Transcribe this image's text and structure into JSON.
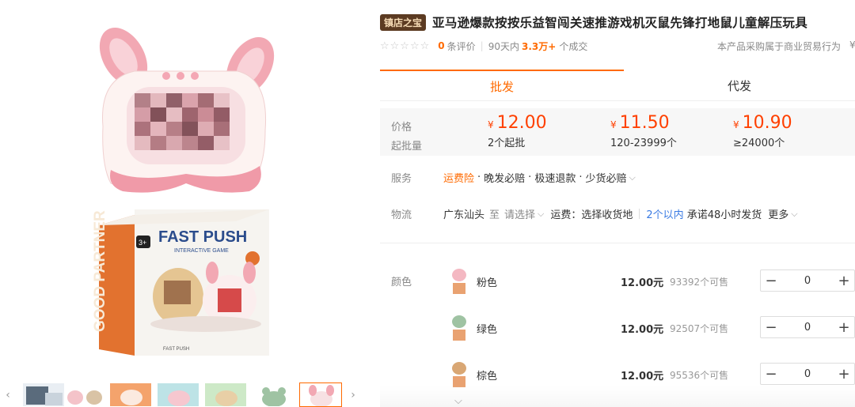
{
  "gallery": {
    "box_brand": "FAST PUSH",
    "box_sub": "INTERACTIVE GAME",
    "box_side": "GOOD PARTNER",
    "box_age": "3+",
    "box_footer": "FAST PUSH",
    "thumb_count": 7,
    "active_thumb": 6
  },
  "product": {
    "shop_tag": "镇店之宝",
    "title": "亚马逊爆款按按乐益智闯关速推游戏机灭鼠先锋打地鼠儿童解压玩具"
  },
  "rating": {
    "stars": "☆☆☆☆☆",
    "review_count": "0",
    "review_label": "条评价",
    "period": "90天内",
    "sold": "3.3万+",
    "sold_label": "个成交",
    "commerce_note": "本产品采购属于商业贸易行为",
    "commerce_cut": "¥"
  },
  "tabs": [
    {
      "label": "批发",
      "active": true
    },
    {
      "label": "代发",
      "active": false
    }
  ],
  "pricing": {
    "price_label": "价格",
    "moq_label": "起批量",
    "currency": "¥",
    "tiers": [
      {
        "price": "12.00",
        "range": "2个起批"
      },
      {
        "price": "11.50",
        "range": "120-23999个"
      },
      {
        "price": "10.90",
        "range": "≥24000个"
      }
    ]
  },
  "service": {
    "label": "服务",
    "highlight": "运费险",
    "items": [
      "晚发必赔",
      "极速退款",
      "少货必赔"
    ]
  },
  "logistics": {
    "label": "物流",
    "origin": "广东汕头",
    "to": "至",
    "dest_placeholder": "请选择",
    "freight": "运费：选择收货地",
    "ship_time": "2个以内",
    "promise": "承诺48小时发货",
    "more": "更多"
  },
  "sku": {
    "label": "颜色",
    "items": [
      {
        "name": "粉色",
        "price": "12.00元",
        "stock": "93392个可售",
        "qty": "0",
        "color": "#f4b8c2"
      },
      {
        "name": "绿色",
        "price": "12.00元",
        "stock": "92507个可售",
        "qty": "0",
        "color": "#9fc3a3"
      },
      {
        "name": "棕色",
        "price": "12.00元",
        "stock": "95536个可售",
        "qty": "0",
        "color": "#d9a774"
      }
    ],
    "minus": "−",
    "plus": "+"
  },
  "colors": {
    "accent": "#ff6a00",
    "price_red": "#ff4000",
    "shop_tag_bg": "#5c3b22",
    "link_blue": "#3a7be3"
  }
}
